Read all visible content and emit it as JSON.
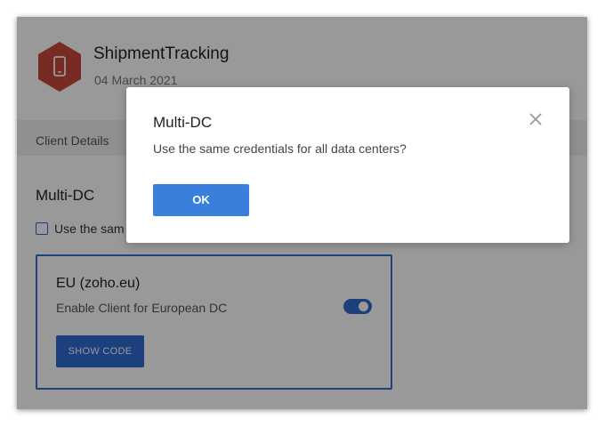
{
  "app": {
    "title": "ShipmentTracking",
    "date": "04 March 2021",
    "logo_icon": "mobile-phone-icon"
  },
  "tabs": [
    {
      "label": "Client Details"
    }
  ],
  "section": {
    "title": "Multi-DC",
    "checkbox_label": "Use the sam",
    "checkbox_checked": false
  },
  "dc_card": {
    "title": "EU (zoho.eu)",
    "subtitle": "Enable Client for European DC",
    "toggle_on": true,
    "button_label": "SHOW CODE"
  },
  "modal": {
    "title": "Multi-DC",
    "message": "Use the same credentials for all data centers?",
    "ok_label": "OK",
    "close_icon": "close-icon"
  },
  "colors": {
    "accent": "#2d6bd0",
    "ok_button": "#3a7fdb",
    "logo": "#c8493a"
  }
}
